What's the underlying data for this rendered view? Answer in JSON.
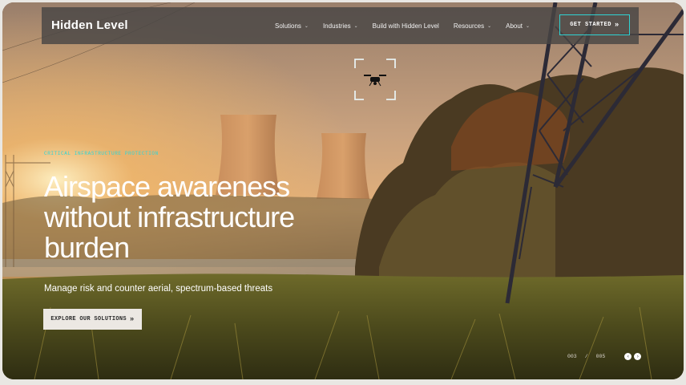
{
  "brand": {
    "name": "Hidden Level"
  },
  "nav": {
    "items": [
      {
        "label": "Solutions",
        "has_menu": true
      },
      {
        "label": "Industries",
        "has_menu": true
      },
      {
        "label": "Build with Hidden Level",
        "has_menu": false
      },
      {
        "label": "Resources",
        "has_menu": true
      },
      {
        "label": "About",
        "has_menu": true
      }
    ],
    "cta_label": "GET STARTED",
    "cta_icon": "double-chevron-right-icon"
  },
  "hero": {
    "eyebrow": "CRITICAL INFRASTRUCTURE PROTECTION",
    "headline_line1": "Airspace awareness",
    "headline_line2": "without infrastructure",
    "headline_line3": "burden",
    "subheadline": "Manage risk and counter aerial, spectrum-based threats",
    "button_label": "EXPLORE OUR SOLUTIONS",
    "button_icon": "double-chevron-right-icon"
  },
  "slider": {
    "current": "003",
    "separator": "/",
    "total": "005"
  },
  "colors": {
    "accent": "#2fd6d6",
    "nav_bg": "#484644",
    "button_bg": "#ece8e3"
  }
}
